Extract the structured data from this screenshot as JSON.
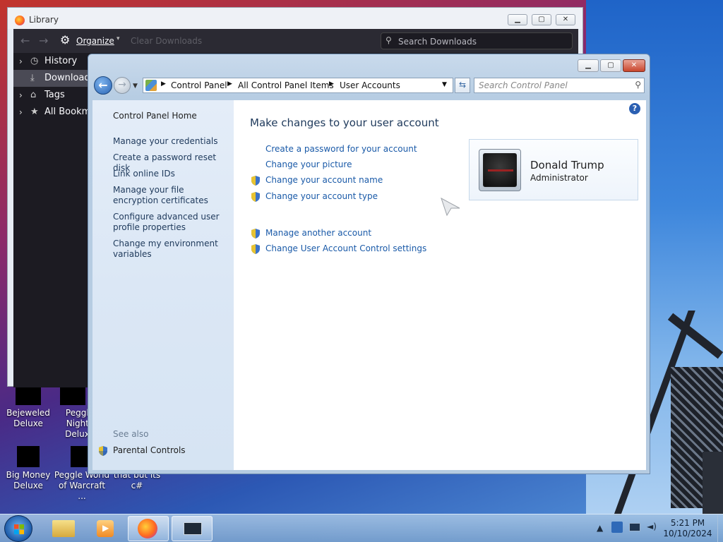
{
  "library": {
    "title": "Library",
    "toolbar": {
      "organize_label": "Organize",
      "clear_downloads_label": "Clear Downloads",
      "search_placeholder": "Search Downloads"
    },
    "sidebar": [
      {
        "label": "History",
        "icon": "clock-icon"
      },
      {
        "label": "Downloads",
        "icon": "download-icon",
        "selected": true
      },
      {
        "label": "Tags",
        "icon": "tag-icon"
      },
      {
        "label": "All Bookmarks",
        "icon": "star-icon"
      }
    ]
  },
  "control_panel": {
    "breadcrumb": [
      "Control Panel",
      "All Control Panel Items",
      "User Accounts"
    ],
    "search_placeholder": "Search Control Panel",
    "left": {
      "home_label": "Control Panel Home",
      "links": [
        "Manage your credentials",
        "Create a password reset disk",
        "Link online IDs",
        "Manage your file encryption certificates",
        "Configure advanced user profile properties",
        "Change my environment variables"
      ],
      "see_also_label": "See also",
      "parental_controls_label": "Parental Controls"
    },
    "main": {
      "heading": "Make changes to your user account",
      "links": [
        {
          "label": "Create a password for your account",
          "shield": false
        },
        {
          "label": "Change your picture",
          "shield": false
        },
        {
          "label": "Change your account name",
          "shield": true
        },
        {
          "label": "Change your account type",
          "shield": true
        },
        {
          "label": "Manage another account",
          "shield": true
        },
        {
          "label": "Change User Account Control settings",
          "shield": true
        }
      ],
      "user": {
        "name": "Donald Trump",
        "role": "Administrator"
      }
    }
  },
  "desktop_icons": [
    {
      "label": "Bejeweled Deluxe"
    },
    {
      "label": "Peggle Nights Deluxe"
    },
    {
      "label": "Big Money Deluxe"
    },
    {
      "label": "Peggle World of Warcraft ..."
    },
    {
      "label": "that but its c#"
    }
  ],
  "taskbar": {
    "time": "5:21 PM",
    "date": "10/10/2024"
  },
  "colors": {
    "link": "#1a5aa8",
    "heading": "#1e395b",
    "selection": "#4a4a55"
  }
}
